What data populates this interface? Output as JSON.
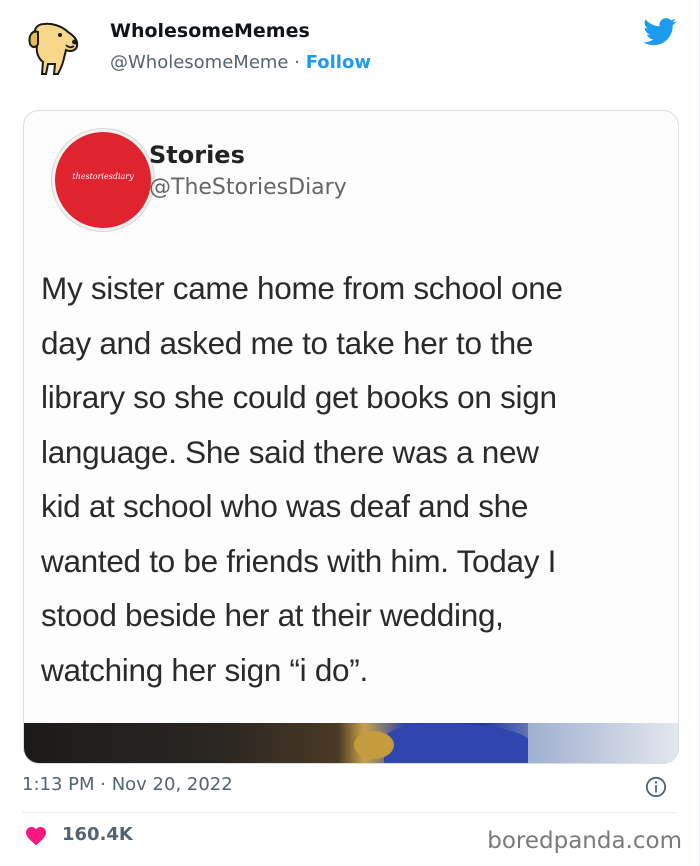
{
  "author": {
    "name": "WholesomeMemes",
    "handle": "@WholesomeMeme",
    "separator": " · ",
    "follow_label": "Follow"
  },
  "embedded": {
    "name": "Stories",
    "handle": "@TheStoriesDiary",
    "logo_text": "thestoriesdiary",
    "text_lines": [
      "My sister came home from school one",
      "day and asked me to take her to the",
      "library so she could get books on sign",
      "language. She said there was a new",
      "kid at school who was deaf and she",
      "wanted to be friends with him. Today I",
      "stood beside her at their wedding,",
      "watching her sign “i do”."
    ]
  },
  "timestamp": "1:13 PM · Nov 20, 2022",
  "likes": "160.4K",
  "watermark": "boredpanda.com",
  "icons": {
    "brand": "twitter-bird-icon",
    "info": "info-icon",
    "like": "heart-icon"
  },
  "colors": {
    "accent": "#1d9bf0",
    "heart": "#f91880",
    "muted": "#536471",
    "stories_red": "#e0242f"
  }
}
